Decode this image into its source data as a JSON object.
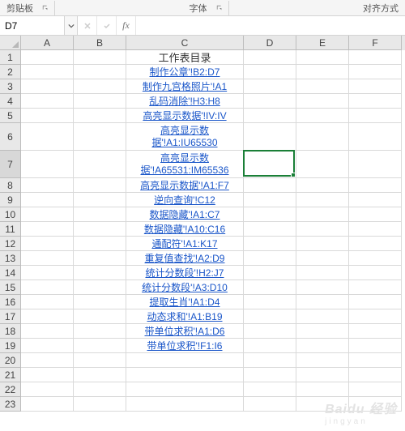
{
  "ribbon": {
    "group_clipboard": "剪贴板",
    "group_font": "字体",
    "group_alignment": "对齐方式"
  },
  "namebox": {
    "value": "D7"
  },
  "formula_bar": {
    "value": ""
  },
  "columns": [
    "A",
    "B",
    "C",
    "D",
    "E",
    "F"
  ],
  "col_widths": {
    "A": 65,
    "B": 65,
    "C": 145,
    "D": 65,
    "E": 65,
    "F": 65
  },
  "rows": [
    {
      "n": 1,
      "h": 18,
      "c": "工作表目录",
      "link": false,
      "multi": false
    },
    {
      "n": 2,
      "h": 18,
      "c": "制作公章'!B2:D7",
      "link": true,
      "multi": false
    },
    {
      "n": 3,
      "h": 18,
      "c": "制作九宫格照片'!A1",
      "link": true,
      "multi": false
    },
    {
      "n": 4,
      "h": 18,
      "c": "乱码消除'!H3:H8",
      "link": true,
      "multi": false
    },
    {
      "n": 5,
      "h": 18,
      "c": "高亮显示数据'!IV:IV",
      "link": true,
      "multi": false
    },
    {
      "n": 6,
      "h": 34,
      "c": "高亮显示数据'!A1:IU65530",
      "link": true,
      "multi": true
    },
    {
      "n": 7,
      "h": 34,
      "c": "高亮显示数据'!A65531:IM65536",
      "link": true,
      "multi": true
    },
    {
      "n": 8,
      "h": 18,
      "c": "高亮显示数据'!A1:F7",
      "link": true,
      "multi": false
    },
    {
      "n": 9,
      "h": 18,
      "c": "逆向查询'!C12",
      "link": true,
      "multi": false
    },
    {
      "n": 10,
      "h": 18,
      "c": "数据隐藏'!A1:C7",
      "link": true,
      "multi": false
    },
    {
      "n": 11,
      "h": 18,
      "c": "数据隐藏'!A10:C16",
      "link": true,
      "multi": false
    },
    {
      "n": 12,
      "h": 18,
      "c": "通配符'!A1:K17",
      "link": true,
      "multi": false
    },
    {
      "n": 13,
      "h": 18,
      "c": "重复值查找'!A2:D9",
      "link": true,
      "multi": false
    },
    {
      "n": 14,
      "h": 18,
      "c": "统计分数段'!H2:J7",
      "link": true,
      "multi": false
    },
    {
      "n": 15,
      "h": 18,
      "c": "统计分数段'!A3:D10",
      "link": true,
      "multi": false
    },
    {
      "n": 16,
      "h": 18,
      "c": "提取生肖'!A1:D4",
      "link": true,
      "multi": false
    },
    {
      "n": 17,
      "h": 18,
      "c": "动态求和'!A1:B19",
      "link": true,
      "multi": false
    },
    {
      "n": 18,
      "h": 18,
      "c": "带单位求积'!A1:D6",
      "link": true,
      "multi": false
    },
    {
      "n": 19,
      "h": 18,
      "c": "带单位求积'!F1:I6",
      "link": true,
      "multi": false
    },
    {
      "n": 20,
      "h": 18,
      "c": "",
      "link": false,
      "multi": false
    },
    {
      "n": 21,
      "h": 18,
      "c": "",
      "link": false,
      "multi": false
    },
    {
      "n": 22,
      "h": 18,
      "c": "",
      "link": false,
      "multi": false
    },
    {
      "n": 23,
      "h": 18,
      "c": "",
      "link": false,
      "multi": false
    }
  ],
  "active_cell": "D7",
  "watermark": {
    "main": "Baidu 经验",
    "sub": "jingyan"
  }
}
